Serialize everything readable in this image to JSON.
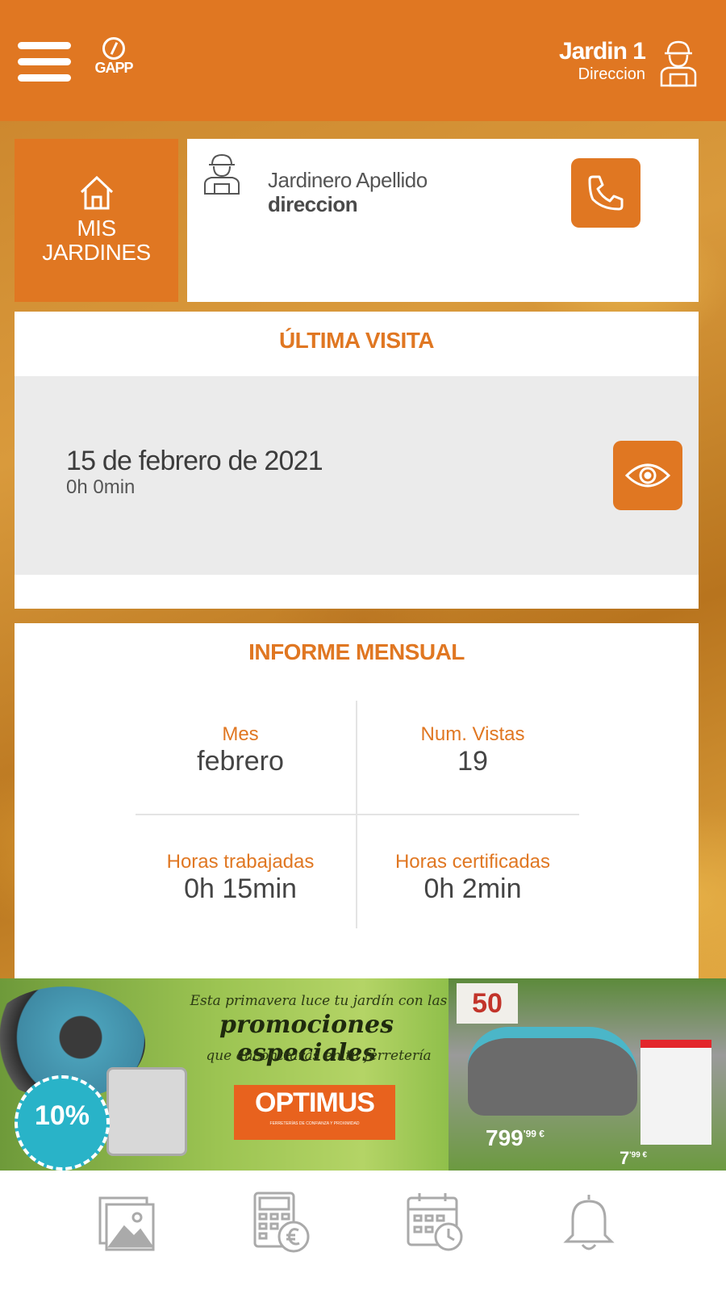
{
  "header": {
    "logo_text": "GAPP",
    "garden_title": "Jardin 1",
    "garden_subtitle": "Direccion"
  },
  "home_tile": {
    "label_line1": "MIS",
    "label_line2": "JARDINES",
    "icon": "home-icon"
  },
  "gardener": {
    "name": "Jardinero Apellido",
    "address": "direccion",
    "icon": "gardener-icon",
    "call_icon": "phone-icon"
  },
  "last_visit": {
    "title": "ÚLTIMA VISITA",
    "date": "15 de febrero de 2021",
    "duration": "0h 0min",
    "view_icon": "eye-icon"
  },
  "monthly_report": {
    "title": "INFORME MENSUAL",
    "stats": [
      {
        "label": "Mes",
        "value": "febrero"
      },
      {
        "label": "Num. Vistas",
        "value": "19"
      },
      {
        "label": "Horas trabajadas",
        "value": "0h 15min"
      },
      {
        "label": "Horas certificadas",
        "value": "0h 2min"
      }
    ]
  },
  "promo": {
    "line1": "Esta primavera luce tu jardín con las",
    "line2": "promociones especiales",
    "line3": "que encontrarás en tu ferretería",
    "brand": "OPTIMUS",
    "brand_tagline": "FERRETERÍAS DE CONFIANZA Y PROXIMIDAD",
    "discount": "10%",
    "anniversary": "50",
    "price_main": "799",
    "price_main_cents": "'99 €",
    "price_small": "7",
    "price_small_cents": "'99 €"
  },
  "tabbar": {
    "items": [
      "gallery-icon",
      "calculator-euro-icon",
      "calendar-clock-icon",
      "bell-icon"
    ]
  },
  "colors": {
    "accent": "#e07722",
    "panel_gray": "#ebebeb",
    "text_dark": "#444444"
  }
}
